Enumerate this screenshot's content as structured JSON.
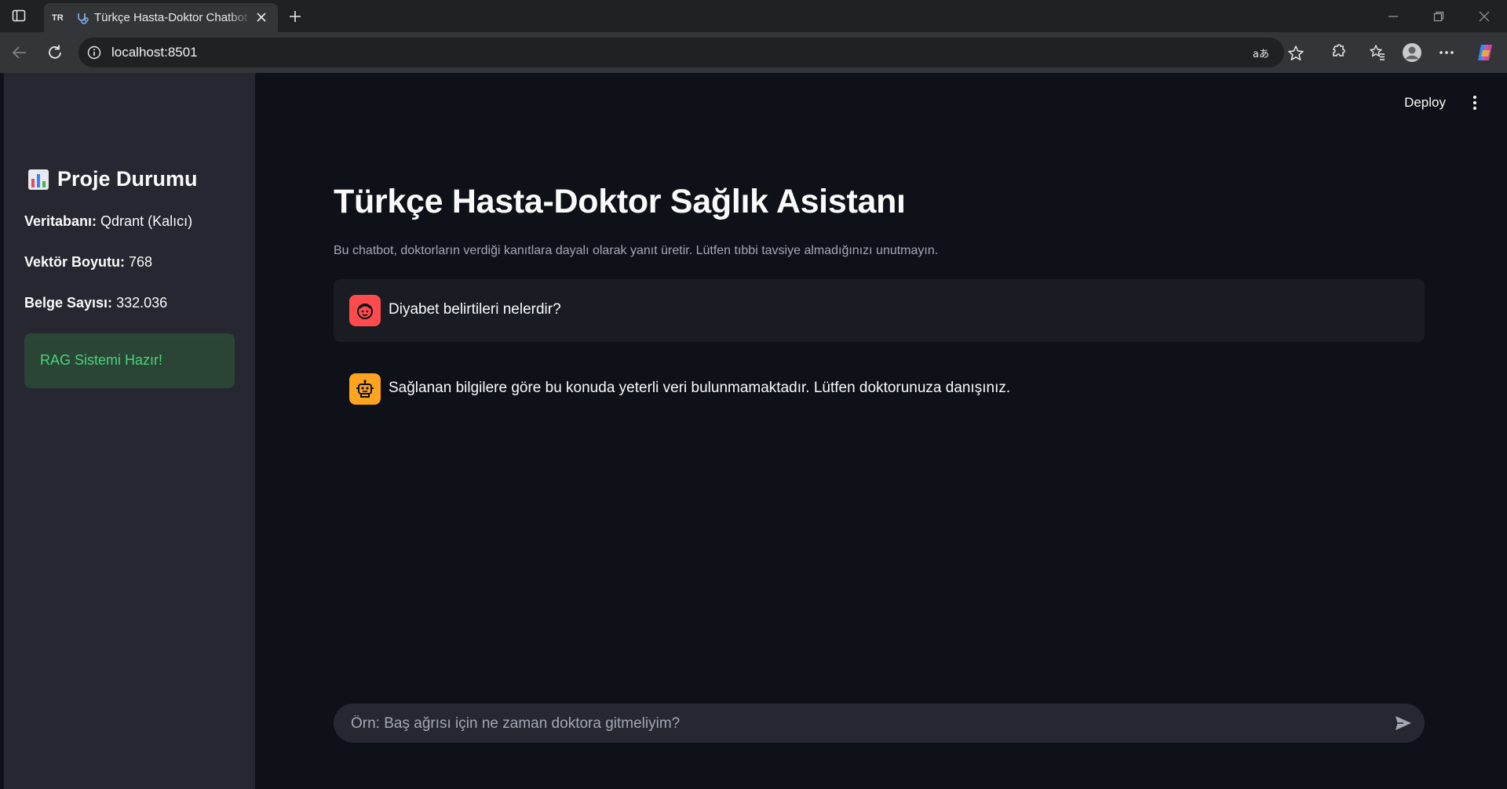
{
  "browser": {
    "tab_badge": "TR",
    "tab_title": "Türkçe Hasta-Doktor Chatbot",
    "url": "localhost:8501"
  },
  "sidebar": {
    "title": "Proje Durumu",
    "stats": [
      {
        "label": "Veritabanı:",
        "value": "Qdrant (Kalıcı)"
      },
      {
        "label": "Vektör Boyutu:",
        "value": "768"
      },
      {
        "label": "Belge Sayısı:",
        "value": "332.036"
      }
    ],
    "status": "RAG Sistemi Hazır!"
  },
  "header": {
    "deploy_label": "Deploy"
  },
  "main": {
    "title": "Türkçe Hasta-Doktor Sağlık Asistanı",
    "caption": "Bu chatbot, doktorların verdiği kanıtlara dayalı olarak yanıt üretir. Lütfen tıbbi tavsiye almadığınızı unutmayın.",
    "messages": [
      {
        "role": "user",
        "text": "Diyabet belirtileri nelerdir?"
      },
      {
        "role": "assistant",
        "text": "Sağlanan bilgilere göre bu konuda yeterli veri bulunmamaktadır. Lütfen doktorunuza danışınız."
      }
    ],
    "input_placeholder": "Örn: Baş ağrısı için ne zaman doktora gitmeliyim?"
  },
  "colors": {
    "user_avatar": "#ff4b4b",
    "assistant_avatar": "#ffa421",
    "success_text": "#4bd37b",
    "success_bg": "#2a4535",
    "sidebar_bg": "#262730",
    "main_bg": "#0e1117"
  },
  "icons": [
    "sidebar-toggle-icon",
    "chatbot-favicon",
    "close-icon",
    "plus-icon",
    "minimize-icon",
    "restore-icon",
    "back-icon",
    "reload-icon",
    "info-icon",
    "read-aloud-icon",
    "favorite-star-icon",
    "extensions-icon",
    "favorites-icon",
    "profile-icon",
    "more-icon",
    "copilot-icon",
    "bar-chart-icon",
    "kebab-menu-icon",
    "user-face-icon",
    "robot-icon",
    "send-icon"
  ]
}
